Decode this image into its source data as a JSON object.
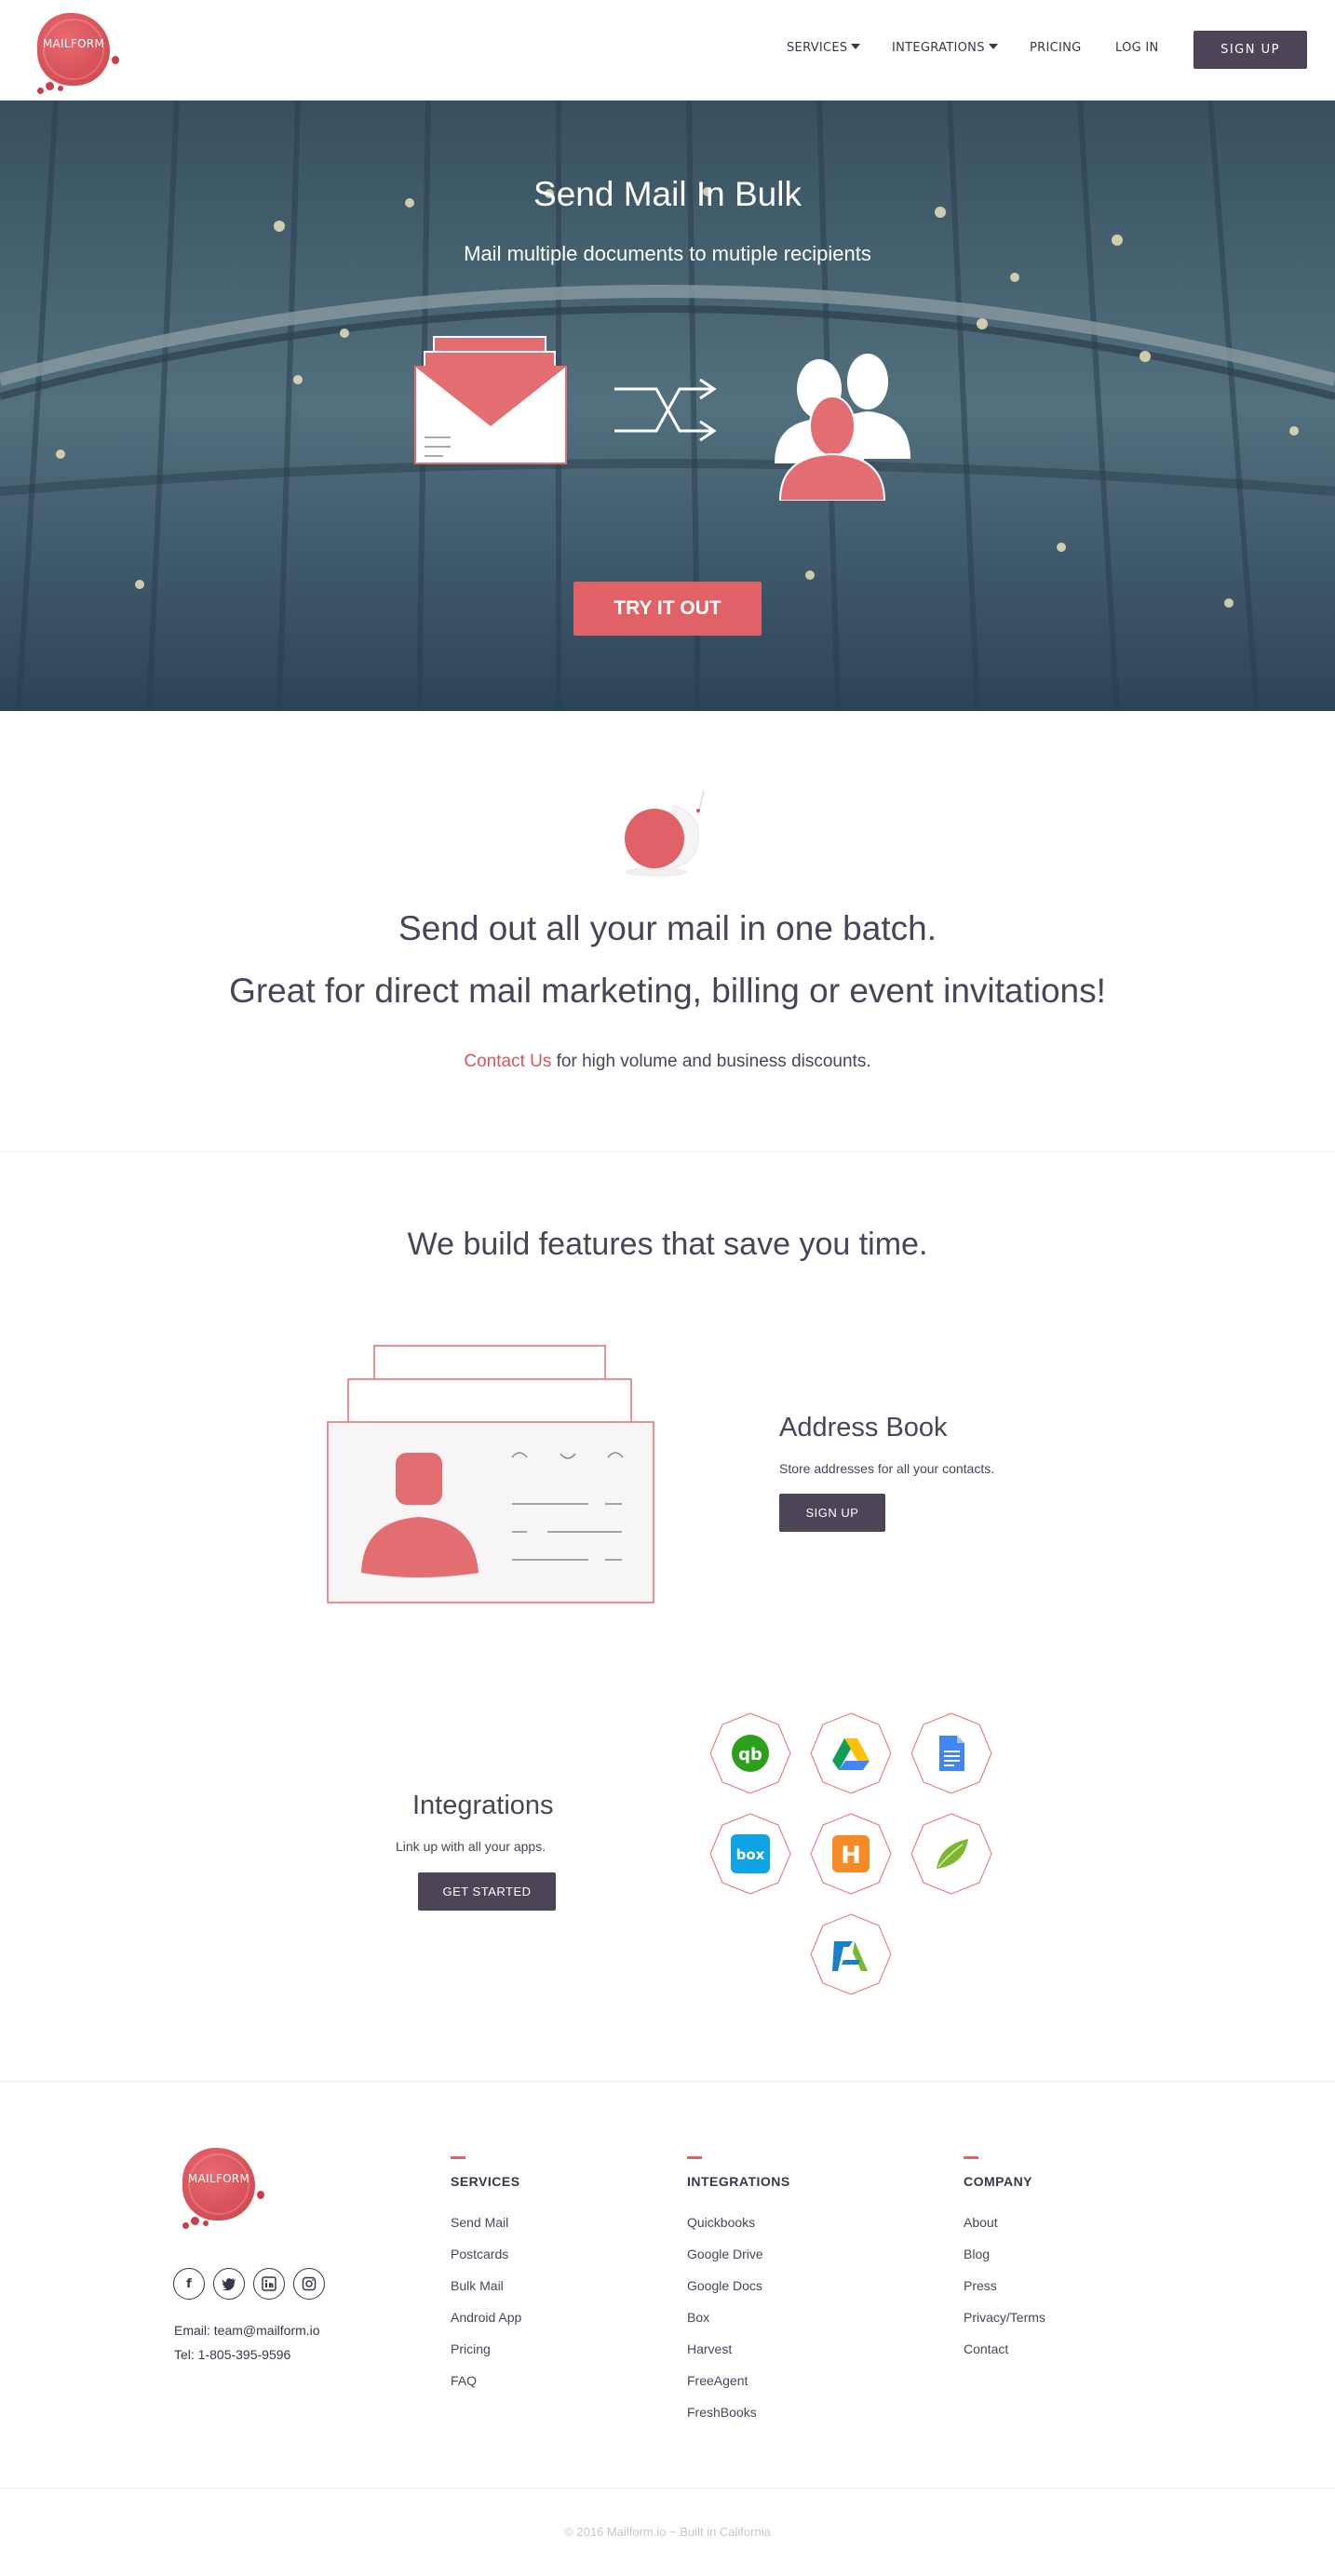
{
  "brand": {
    "logo_text": "MAILFORM",
    "accent": "#e06166",
    "dark": "#4d4458"
  },
  "nav": {
    "items": [
      {
        "label": "SERVICES",
        "dropdown": true
      },
      {
        "label": "INTEGRATIONS",
        "dropdown": true
      },
      {
        "label": "PRICING",
        "dropdown": false
      },
      {
        "label": "LOG IN",
        "dropdown": false
      }
    ],
    "signup_label": "SIGN UP"
  },
  "hero": {
    "title": "Send Mail In Bulk",
    "subtitle": "Mail multiple documents to mutiple recipients",
    "cta_label": "TRY IT OUT"
  },
  "batch": {
    "icon": "snail-icon",
    "line1": "Send out all your mail in one batch.",
    "line2": "Great for direct mail marketing, billing or event invitations!",
    "contact_link": "Contact Us",
    "line3_rest": " for high volume and business discounts."
  },
  "features": {
    "title": "We build features that save you time.",
    "address_book": {
      "title": "Address Book",
      "desc": "Store addresses for all your contacts.",
      "button": "SIGN UP"
    },
    "integrations": {
      "title": "Integrations",
      "desc": "Link up with all your apps.",
      "button": "GET STARTED",
      "apps": [
        "quickbooks-icon",
        "google-drive-icon",
        "google-docs-icon",
        "box-icon",
        "harvest-icon",
        "freeagent-icon",
        "freshbooks-icon"
      ]
    }
  },
  "footer": {
    "social": [
      "facebook-icon",
      "twitter-icon",
      "linkedin-icon",
      "instagram-icon"
    ],
    "email": "Email: team@mailform.io",
    "tel": "Tel: 1-805-395-9596",
    "columns": [
      {
        "heading": "SERVICES",
        "links": [
          "Send Mail",
          "Postcards",
          "Bulk Mail",
          "Android App",
          "Pricing",
          "FAQ"
        ]
      },
      {
        "heading": "INTEGRATIONS",
        "links": [
          "Quickbooks",
          "Google Drive",
          "Google Docs",
          "Box",
          "Harvest",
          "FreeAgent",
          "FreshBooks"
        ]
      },
      {
        "heading": "COMPANY",
        "links": [
          "About",
          "Blog",
          "Press",
          "Privacy/Terms",
          "Contact"
        ]
      }
    ],
    "copyright": "© 2016 Mailform.io ~ Built in California"
  }
}
